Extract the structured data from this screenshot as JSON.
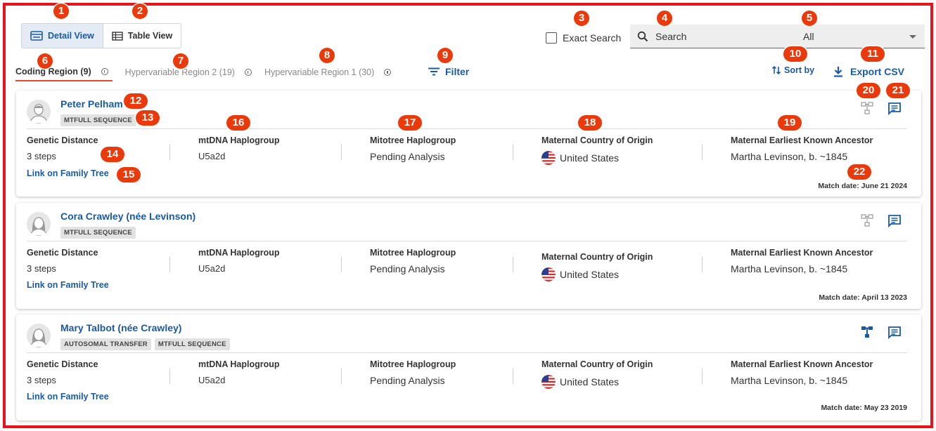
{
  "toolbar": {
    "detail_view_label": "Detail View",
    "table_view_label": "Table View",
    "exact_search_label": "Exact Search",
    "search_placeholder": "Search",
    "select_value": "All"
  },
  "tabs": [
    {
      "label": "Coding Region (9)",
      "active": true
    },
    {
      "label": "Hypervariable Region 2 (19)",
      "active": false
    },
    {
      "label": "Hypervariable Region 1 (30)",
      "active": false
    }
  ],
  "actions": {
    "filter_label": "Filter",
    "sort_label": "Sort by",
    "export_label": "Export CSV"
  },
  "column_labels": {
    "genetic_distance": "Genetic Distance",
    "mtdna_haplogroup": "mtDNA Haplogroup",
    "mitotree_haplogroup": "Mitotree Haplogroup",
    "maternal_country": "Maternal Country of Origin",
    "maternal_ancestor": "Maternal Earliest Known Ancestor",
    "family_tree_link": "Link on Family Tree"
  },
  "matches": [
    {
      "name": "Peter Pelham",
      "avatar": "male",
      "tags": [
        "MTFULL SEQUENCE"
      ],
      "genetic_distance": "3 steps",
      "mtdna_haplogroup": "U5a2d",
      "mitotree_haplogroup": "Pending Analysis",
      "country": "United States",
      "ancestor": "Martha Levinson, b. ~1845",
      "match_date": "Match date: June 21 2024",
      "tree_icon_active": false
    },
    {
      "name": "Cora Crawley (née Levinson)",
      "avatar": "female",
      "tags": [
        "MTFULL SEQUENCE"
      ],
      "genetic_distance": "3 steps",
      "mtdna_haplogroup": "U5a2d",
      "mitotree_haplogroup": "Pending Analysis",
      "country": "United States",
      "ancestor": "Martha Levinson, b. ~1845",
      "match_date": "Match date: April 13 2023",
      "tree_icon_active": false
    },
    {
      "name": "Mary Talbot (née Crawley)",
      "avatar": "female",
      "tags": [
        "AUTOSOMAL TRANSFER",
        "MTFULL SEQUENCE"
      ],
      "genetic_distance": "3 steps",
      "mtdna_haplogroup": "U5a2d",
      "mitotree_haplogroup": "Pending Analysis",
      "country": "United States",
      "ancestor": "Martha Levinson, b. ~1845",
      "match_date": "Match date: May 23 2019",
      "tree_icon_active": true
    }
  ],
  "callouts": [
    "1",
    "2",
    "3",
    "4",
    "5",
    "6",
    "7",
    "8",
    "9",
    "10",
    "11",
    "12",
    "13",
    "14",
    "15",
    "16",
    "17",
    "18",
    "19",
    "20",
    "21",
    "22"
  ],
  "colors": {
    "accent_blue": "#1a5aa5",
    "callout": "#ea3a0b",
    "frame": "#e8141c",
    "active_tab_underline": "#e8472f"
  }
}
